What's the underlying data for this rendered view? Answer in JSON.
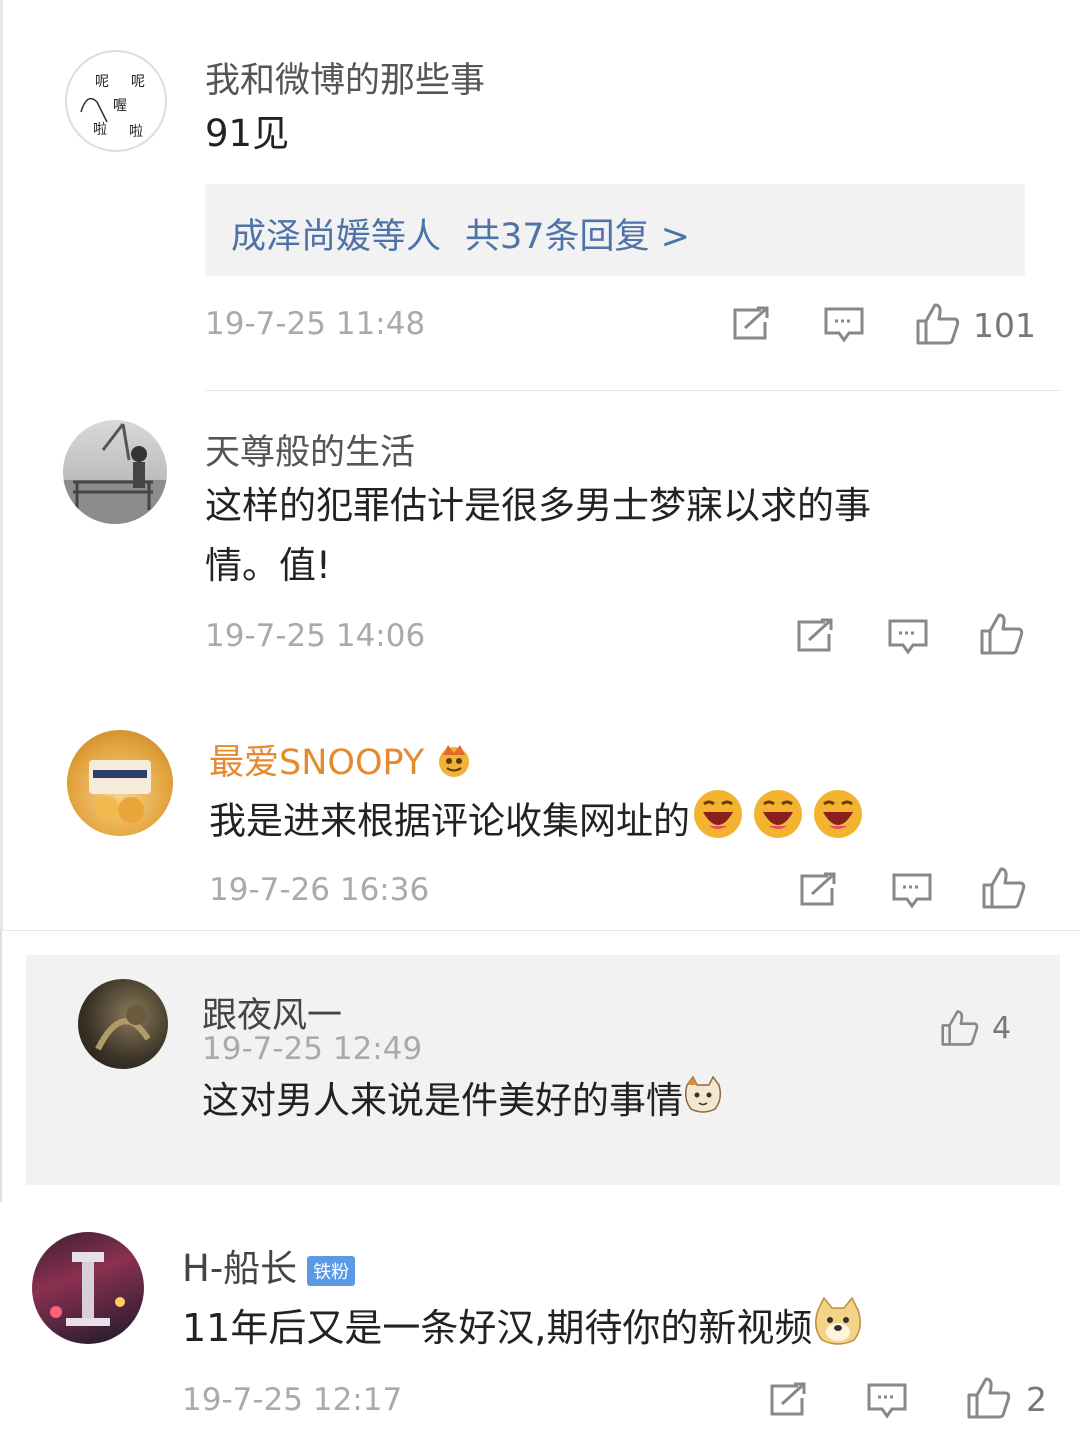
{
  "comments": [
    {
      "username": "我和微博的那些事",
      "text": "91见",
      "reply_summary": "成泽尚媛等人",
      "reply_count": "共37条回复 >",
      "time": "19-7-25 11:48",
      "likes": "101"
    },
    {
      "username": "天尊般的生活",
      "text_line1": "这样的犯罪估计是很多男士梦寐以求的事",
      "text_line2": "情。值!",
      "time": "19-7-25 14:06"
    },
    {
      "username": "最爱SNOOPY",
      "text": "我是进来根据评论收集网址的",
      "time": "19-7-26 16:36"
    },
    {
      "username": "跟夜风一",
      "time": "19-7-25 12:49",
      "text": "这对男人来说是件美好的事情",
      "likes": "4"
    },
    {
      "username": "H-船长",
      "badge": "铁粉",
      "text": "11年后又是一条好汉,期待你的新视频",
      "time": "19-7-25 12:17",
      "likes": "2"
    }
  ],
  "icons": [
    "share-icon",
    "comment-icon",
    "like-icon",
    "laughing-emoji",
    "cat-emoji",
    "doge-emoji",
    "crown-icon"
  ],
  "colors": {
    "link": "#4f73a8",
    "vip_name": "#e68a2e",
    "badge": "#5b9be6"
  }
}
